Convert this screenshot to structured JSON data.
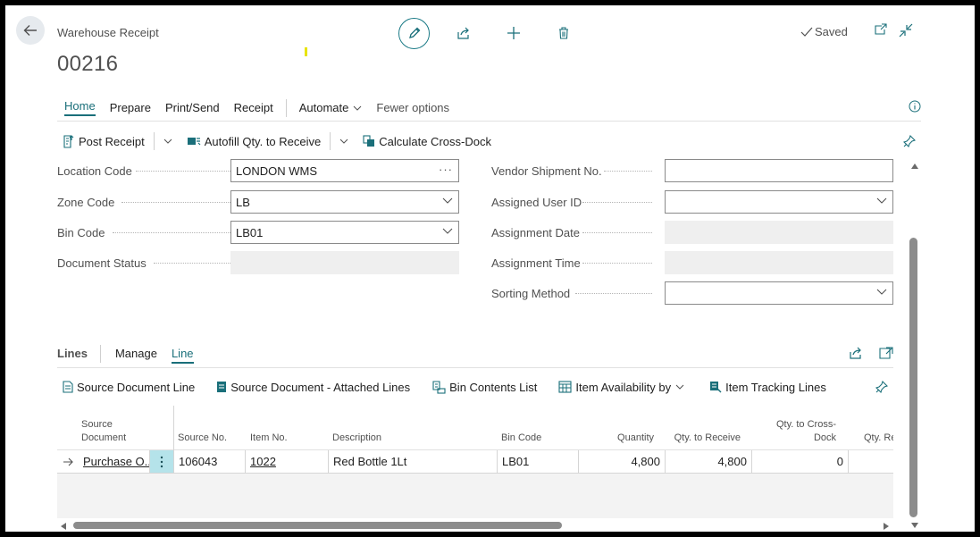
{
  "header": {
    "caption": "Warehouse Receipt",
    "record_no": "00216",
    "saved_label": "Saved"
  },
  "tabs": {
    "items": [
      {
        "label": "Home"
      },
      {
        "label": "Prepare"
      },
      {
        "label": "Print/Send"
      },
      {
        "label": "Receipt"
      },
      {
        "label": "Automate"
      },
      {
        "label": "Fewer options"
      }
    ]
  },
  "commands": {
    "post_receipt": "Post Receipt",
    "autofill": "Autofill Qty. to Receive",
    "cross_dock": "Calculate Cross-Dock"
  },
  "form": {
    "location_code": {
      "label": "Location Code",
      "value": "LONDON WMS"
    },
    "zone_code": {
      "label": "Zone Code",
      "value": "LB"
    },
    "bin_code": {
      "label": "Bin Code",
      "value": "LB01"
    },
    "document_status": {
      "label": "Document Status",
      "value": ""
    },
    "vendor_shipment_no": {
      "label": "Vendor Shipment No.",
      "value": ""
    },
    "assigned_user_id": {
      "label": "Assigned User ID",
      "value": ""
    },
    "assignment_date": {
      "label": "Assignment Date",
      "value": ""
    },
    "assignment_time": {
      "label": "Assignment Time",
      "value": ""
    },
    "sorting_method": {
      "label": "Sorting Method",
      "value": ""
    }
  },
  "lines": {
    "title": "Lines",
    "tabs": [
      {
        "label": "Manage"
      },
      {
        "label": "Line"
      }
    ],
    "commands": {
      "source_document_line": "Source Document Line",
      "attached_lines": "Source Document - Attached Lines",
      "bin_contents": "Bin Contents List",
      "item_availability": "Item Availability by",
      "item_tracking": "Item Tracking Lines"
    },
    "columns": {
      "source_document_1": "Source",
      "source_document_2": "Document",
      "source_no": "Source No.",
      "item_no": "Item No.",
      "description": "Description",
      "bin_code": "Bin Code",
      "quantity": "Quantity",
      "qty_to_receive": "Qty. to Receive",
      "qty_to_cross_dock_1": "Qty. to Cross-",
      "qty_to_cross_dock_2": "Dock",
      "qty_received": "Qty. Re"
    },
    "rows": [
      {
        "source_document": "Purchase O...",
        "source_no": "106043",
        "item_no": "1022",
        "description": "Red Bottle 1Lt",
        "bin_code": "LB01",
        "quantity": "4,800",
        "qty_to_receive": "4,800",
        "qty_to_cross_dock": "0"
      }
    ]
  },
  "colors": {
    "accent": "#1a6f7a",
    "menu_cell": "#b5e3ea",
    "readonly_field": "#efefef"
  }
}
